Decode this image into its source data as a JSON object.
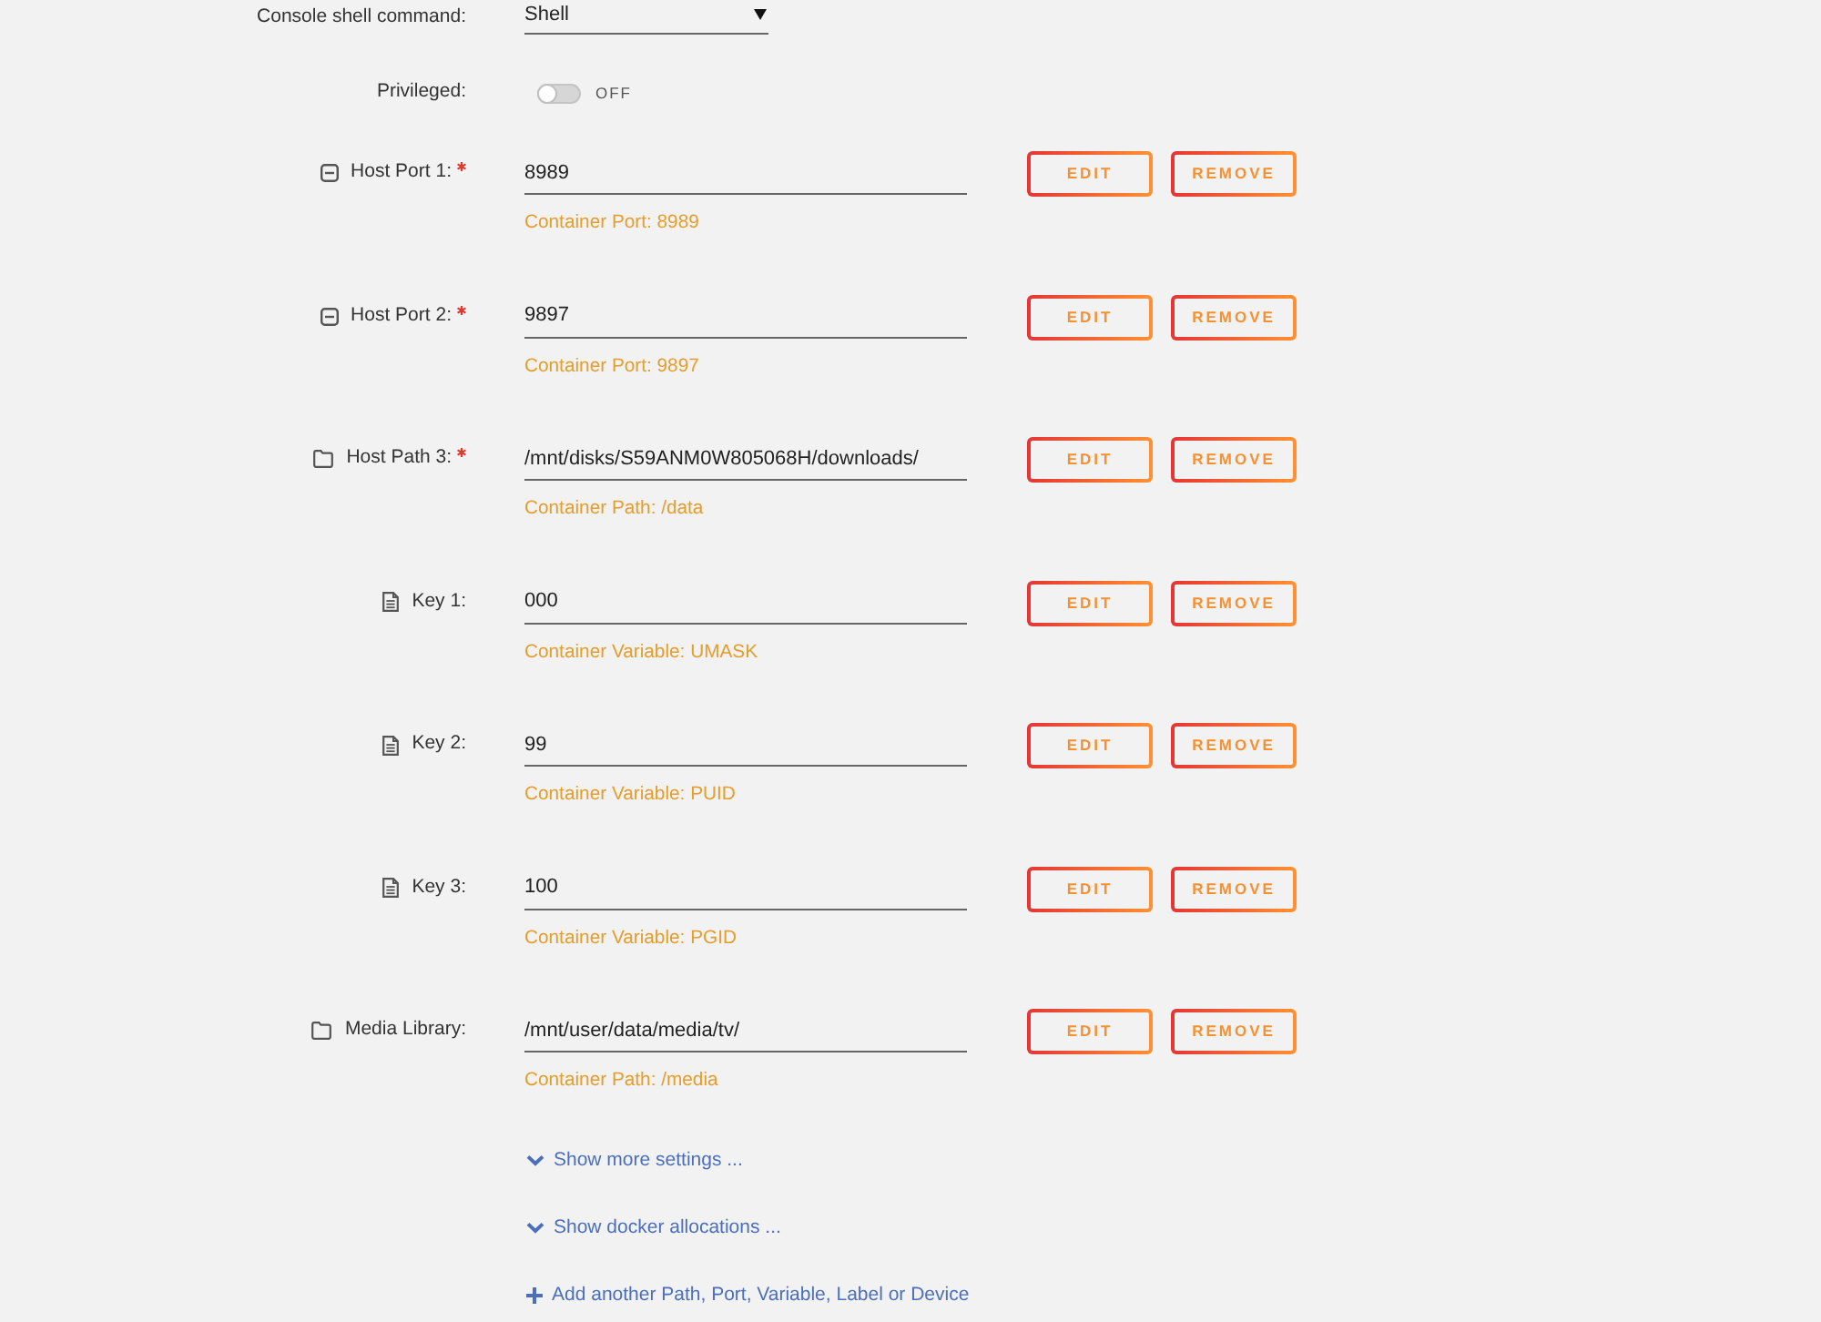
{
  "console_shell": {
    "label": "Console shell command:",
    "value": "Shell"
  },
  "privileged": {
    "label": "Privileged:",
    "on": false,
    "state_text": "OFF"
  },
  "mappings": [
    {
      "kind": "port",
      "label": "Host Port 1:",
      "required": true,
      "value": "8989",
      "hint": "Container Port: 8989",
      "edit": "EDIT",
      "remove": "REMOVE"
    },
    {
      "kind": "port",
      "label": "Host Port 2:",
      "required": true,
      "value": "9897",
      "hint": "Container Port: 9897",
      "edit": "EDIT",
      "remove": "REMOVE"
    },
    {
      "kind": "path",
      "label": "Host Path 3:",
      "required": true,
      "value": "/mnt/disks/S59ANM0W805068H/downloads/",
      "hint": "Container Path: /data",
      "edit": "EDIT",
      "remove": "REMOVE"
    },
    {
      "kind": "variable",
      "label": "Key 1:",
      "required": false,
      "value": "000",
      "hint": "Container Variable: UMASK",
      "edit": "EDIT",
      "remove": "REMOVE"
    },
    {
      "kind": "variable",
      "label": "Key 2:",
      "required": false,
      "value": "99",
      "hint": "Container Variable: PUID",
      "edit": "EDIT",
      "remove": "REMOVE"
    },
    {
      "kind": "variable",
      "label": "Key 3:",
      "required": false,
      "value": "100",
      "hint": "Container Variable: PGID",
      "edit": "EDIT",
      "remove": "REMOVE"
    },
    {
      "kind": "path",
      "label": "Media Library:",
      "required": false,
      "value": "/mnt/user/data/media/tv/",
      "hint": "Container Path: /media",
      "edit": "EDIT",
      "remove": "REMOVE"
    }
  ],
  "links": [
    {
      "kind": "expand",
      "text": "Show more settings ..."
    },
    {
      "kind": "expand",
      "text": "Show docker allocations ..."
    },
    {
      "kind": "add",
      "text": "Add another Path, Port, Variable, Label or Device"
    }
  ]
}
